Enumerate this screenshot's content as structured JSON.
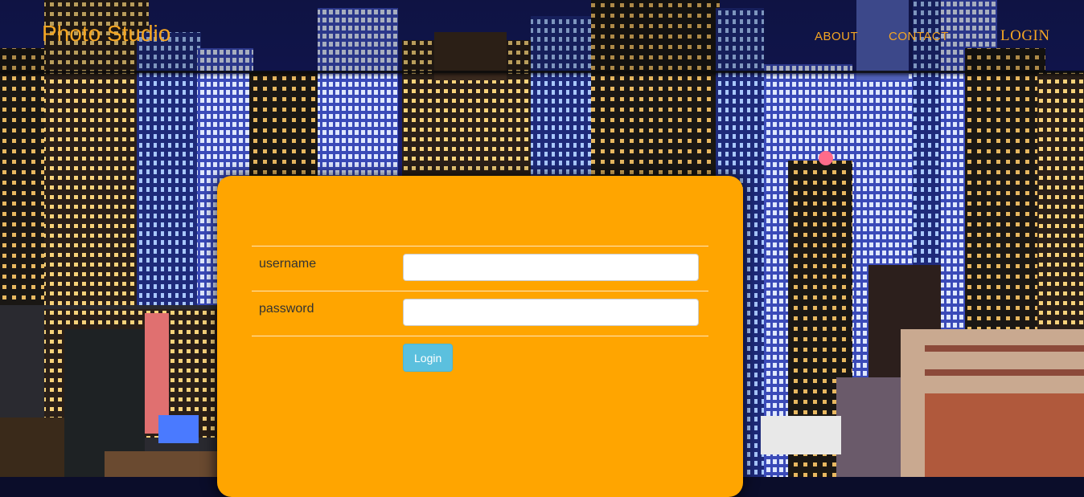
{
  "header": {
    "brand": "Photo Studio",
    "nav": {
      "about": "ABOUT",
      "contact": "CONTACT",
      "login": "LOGIN"
    }
  },
  "login_form": {
    "username_label": "username",
    "username_value": "",
    "password_label": "password",
    "password_value": "",
    "submit_label": "Login"
  },
  "colors": {
    "accent": "#f5a623",
    "card_background": "#ffa500",
    "button": "#5bc0de"
  }
}
